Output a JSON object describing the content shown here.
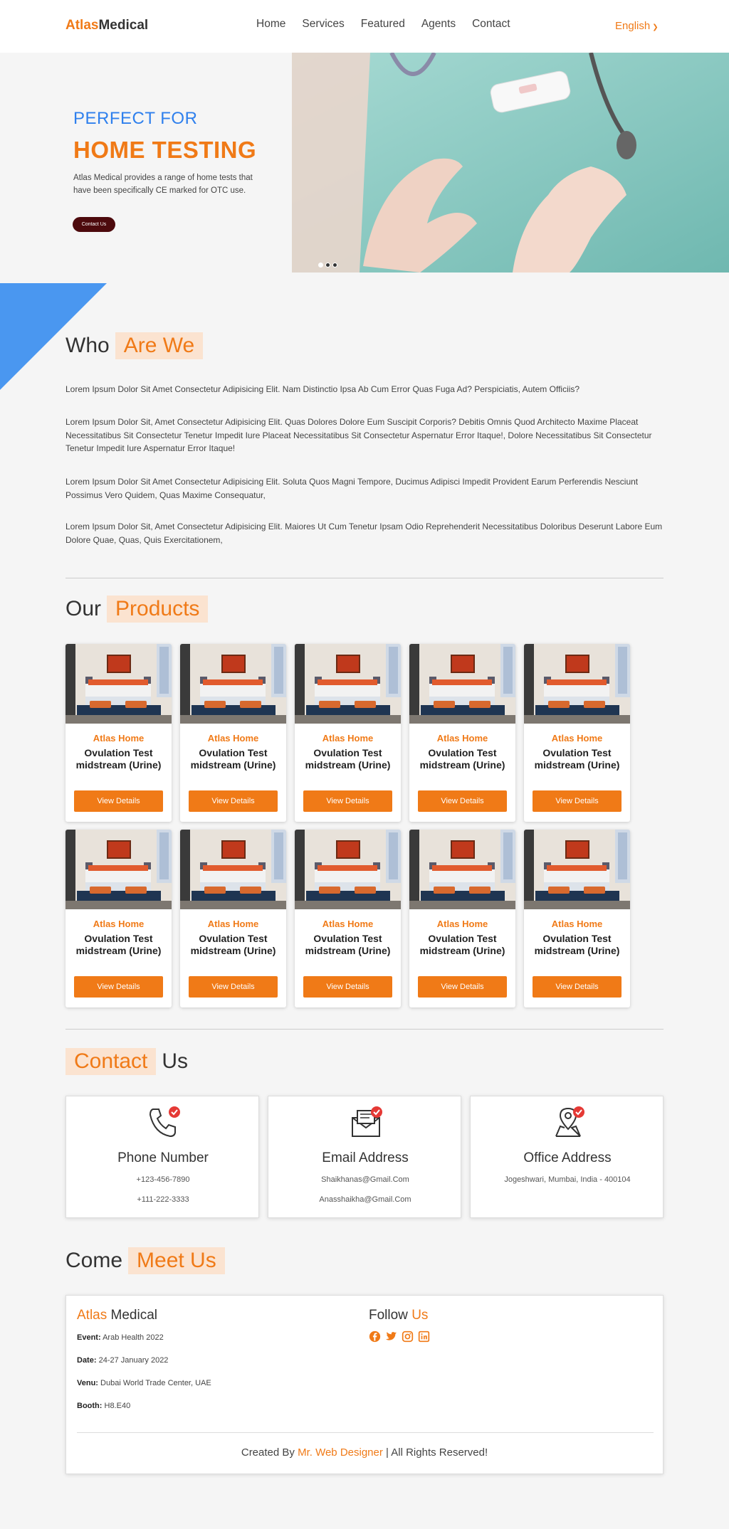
{
  "nav": {
    "brand_part1": "Atlas",
    "brand_part2": "Medical",
    "links": [
      "Home",
      "Services",
      "Featured",
      "Agents",
      "Contact"
    ],
    "language": "English"
  },
  "hero": {
    "subtitle": "PERFECT FOR",
    "title": "HOME TESTING",
    "text": "Atlas Medical provides a range of home tests that have been specifically CE marked for OTC use.",
    "button": "Contact Us"
  },
  "who": {
    "title_plain": "Who",
    "title_highlight": "Are We",
    "paragraphs": [
      "Lorem Ipsum Dolor Sit Amet Consectetur Adipisicing Elit. Nam Distinctio Ipsa Ab Cum Error Quas Fuga Ad? Perspiciatis, Autem Officiis?",
      "Lorem Ipsum Dolor Sit, Amet Consectetur Adipisicing Elit. Quas Dolores Dolore Eum Suscipit Corporis? Debitis Omnis Quod Architecto Maxime Placeat Necessitatibus Sit Consectetur Tenetur Impedit Iure Placeat Necessitatibus Sit Consectetur Aspernatur Error Itaque!, Dolore Necessitatibus Sit Consectetur Tenetur Impedit Iure Aspernatur Error Itaque!",
      "Lorem Ipsum Dolor Sit Amet Consectetur Adipisicing Elit. Soluta Quos Magni Tempore, Ducimus Adipisci Impedit Provident Earum Perferendis Nesciunt Possimus Vero Quidem, Quas Maxime Consequatur,",
      "Lorem Ipsum Dolor Sit, Amet Consectetur Adipisicing Elit. Maiores Ut Cum Tenetur Ipsam Odio Reprehenderit Necessitatibus Doloribus Deserunt Labore Eum Dolore Quae, Quas, Quis Exercitationem,"
    ]
  },
  "products": {
    "title_plain": "Our",
    "title_highlight": "Products",
    "items": [
      {
        "brand": "Atlas Home",
        "name": "Ovulation Test midstream (Urine)",
        "button": "View Details"
      },
      {
        "brand": "Atlas Home",
        "name": "Ovulation Test midstream (Urine)",
        "button": "View Details"
      },
      {
        "brand": "Atlas Home",
        "name": "Ovulation Test midstream (Urine)",
        "button": "View Details"
      },
      {
        "brand": "Atlas Home",
        "name": "Ovulation Test midstream (Urine)",
        "button": "View Details"
      },
      {
        "brand": "Atlas Home",
        "name": "Ovulation Test midstream (Urine)",
        "button": "View Details"
      },
      {
        "brand": "Atlas Home",
        "name": "Ovulation Test midstream (Urine)",
        "button": "View Details"
      },
      {
        "brand": "Atlas Home",
        "name": "Ovulation Test midstream (Urine)",
        "button": "View Details"
      },
      {
        "brand": "Atlas Home",
        "name": "Ovulation Test midstream (Urine)",
        "button": "View Details"
      },
      {
        "brand": "Atlas Home",
        "name": "Ovulation Test midstream (Urine)",
        "button": "View Details"
      },
      {
        "brand": "Atlas Home",
        "name": "Ovulation Test midstream (Urine)",
        "button": "View Details"
      }
    ]
  },
  "contact": {
    "title_highlight": "Contact",
    "title_plain": "Us",
    "cards": [
      {
        "icon": "phone-icon",
        "title": "Phone Number",
        "lines": [
          "+123-456-7890",
          "+111-222-3333"
        ]
      },
      {
        "icon": "email-icon",
        "title": "Email Address",
        "lines": [
          "Shaikhanas@Gmail.Com",
          "Anasshaikha@Gmail.Com"
        ]
      },
      {
        "icon": "location-icon",
        "title": "Office Address",
        "lines": [
          "Jogeshwari, Mumbai, India - 400104"
        ]
      }
    ]
  },
  "meet": {
    "title_plain": "Come",
    "title_highlight": "Meet Us",
    "brand_part1": "Atlas",
    "brand_part2": "Medical",
    "event_label": "Event:",
    "event_value": "Arab Health 2022",
    "date_label": "Date:",
    "date_value": "24-27 January 2022",
    "venue_label": "Venu:",
    "venue_value": "Dubai World Trade Center, UAE",
    "booth_label": "Booth:",
    "booth_value": "H8.E40",
    "follow_plain": "Follow",
    "follow_highlight": "Us",
    "socials": [
      "facebook-icon",
      "twitter-icon",
      "instagram-icon",
      "linkedin-icon"
    ],
    "footer_prefix": "Created By",
    "footer_link": "Mr. Web Designer",
    "footer_suffix": "| All Rights Reserved!"
  },
  "colors": {
    "accent": "#f07a17",
    "blue": "#2f80ed",
    "triangle": "#4a97f0",
    "hero_button": "#4d0a0d",
    "highlight_bg": "#fbe3d0"
  }
}
